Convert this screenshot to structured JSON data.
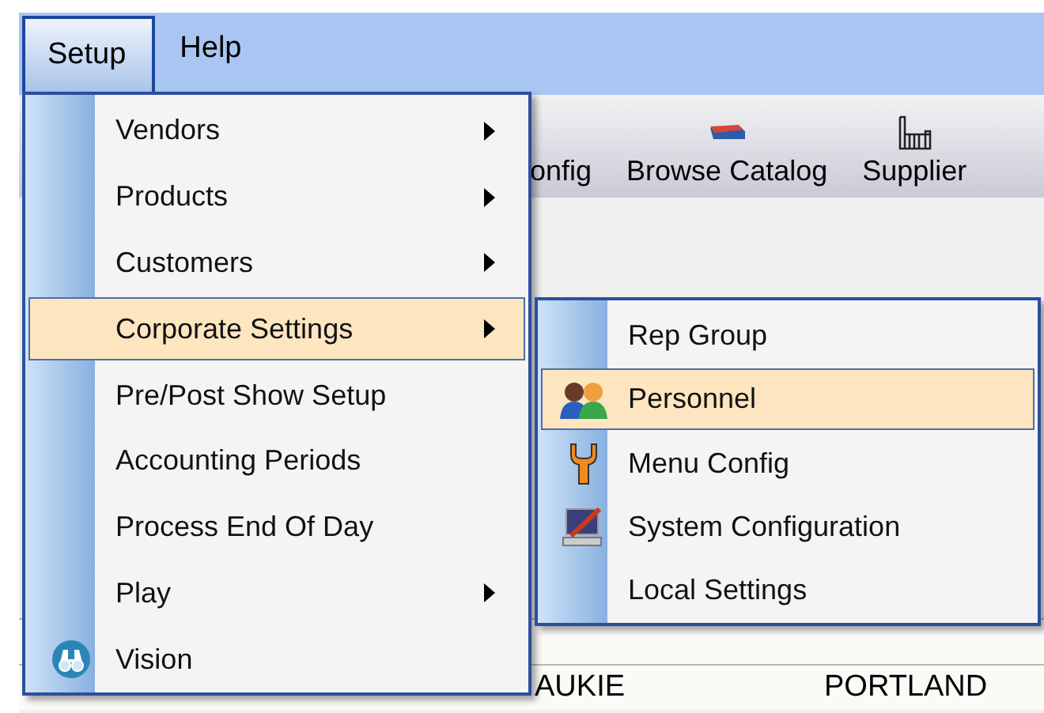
{
  "menu_bar": [
    {
      "label": "Setup",
      "selected": true
    },
    {
      "label": "Help",
      "selected": false
    }
  ],
  "toolbar": [
    {
      "label": "onfig",
      "kind": "plain"
    },
    {
      "label": "Browse Catalog",
      "kind": "catalog"
    },
    {
      "label": "Supplier",
      "kind": "suppliers"
    }
  ],
  "table": {
    "rows": [
      {
        "column_1": "AUKIE",
        "column_2": "PORTLAND"
      }
    ]
  },
  "setup_menu": [
    {
      "label": "Vendors",
      "submenu": true,
      "selected": false,
      "kind": "plain"
    },
    {
      "label": "Products",
      "submenu": true,
      "selected": false,
      "kind": "plain"
    },
    {
      "label": "Customers",
      "submenu": true,
      "selected": false,
      "kind": "plain"
    },
    {
      "label": "Corporate Settings",
      "submenu": true,
      "selected": true,
      "kind": "plain"
    },
    {
      "label": "Pre/Post Show Setup",
      "submenu": false,
      "selected": false,
      "kind": "plain"
    },
    {
      "label": "Accounting Periods",
      "submenu": false,
      "selected": false,
      "kind": "plain"
    },
    {
      "label": "Process End Of Day",
      "submenu": false,
      "selected": false,
      "kind": "plain"
    },
    {
      "label": "Play",
      "submenu": true,
      "selected": false,
      "kind": "plain"
    },
    {
      "label": "Vision",
      "submenu": false,
      "selected": false,
      "kind": "binoculars"
    }
  ],
  "corporate_settings_menu": [
    {
      "label": "Rep Group",
      "selected": false,
      "kind": "plain"
    },
    {
      "label": "Personnel",
      "selected": true,
      "kind": "people"
    },
    {
      "label": "Menu Config",
      "selected": false,
      "kind": "tool"
    },
    {
      "label": "System Configuration",
      "selected": false,
      "kind": "monitor"
    },
    {
      "label": "Local Settings",
      "selected": false,
      "kind": "plain"
    }
  ]
}
